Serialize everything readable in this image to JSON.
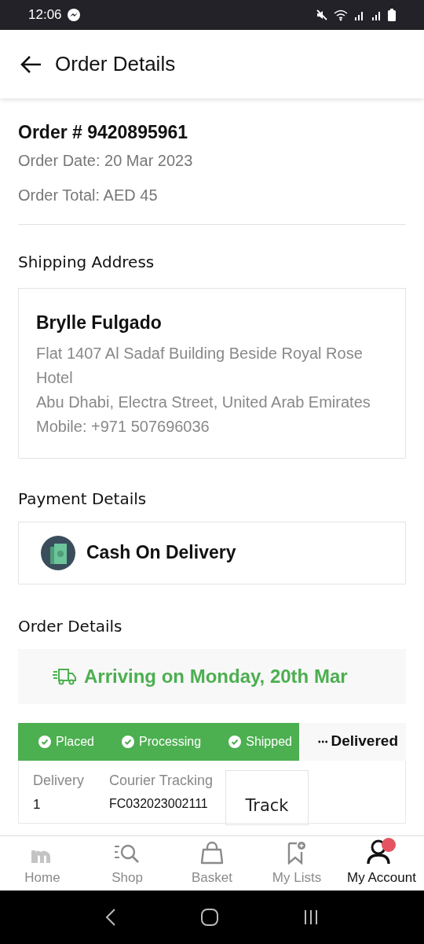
{
  "status_bar": {
    "time": "12:06"
  },
  "header": {
    "title": "Order Details"
  },
  "order": {
    "number": "Order # 9420895961",
    "date": "Order Date: 20 Mar 2023",
    "total": "Order Total: AED 45"
  },
  "shipping": {
    "heading": "Shipping Address",
    "name": "Brylle Fulgado",
    "lines": [
      "Flat 1407 Al Sadaf Building Beside Royal Rose Hotel",
      "Abu Dhabi, Electra Street, United Arab Emirates",
      "Mobile: +971 507696036"
    ]
  },
  "payment": {
    "heading": "Payment Details",
    "method": "Cash On Delivery"
  },
  "order_details": {
    "heading": "Order Details",
    "arrival": "Arriving on Monday, 20th Mar",
    "steps": [
      {
        "label": "Placed",
        "done": true
      },
      {
        "label": "Processing",
        "done": true
      },
      {
        "label": "Shipped",
        "done": true
      },
      {
        "label": "Delivered",
        "done": false
      }
    ],
    "delivery": {
      "delivery_label": "Delivery",
      "delivery_value": "1",
      "tracking_label": "Courier Tracking",
      "tracking_value": "FC032023002111",
      "track_button": "Track"
    }
  },
  "bottom_nav": [
    {
      "label": "Home",
      "selected": false
    },
    {
      "label": "Shop",
      "selected": false
    },
    {
      "label": "Basket",
      "selected": false
    },
    {
      "label": "My Lists",
      "selected": false
    },
    {
      "label": "My Account",
      "selected": true
    }
  ]
}
